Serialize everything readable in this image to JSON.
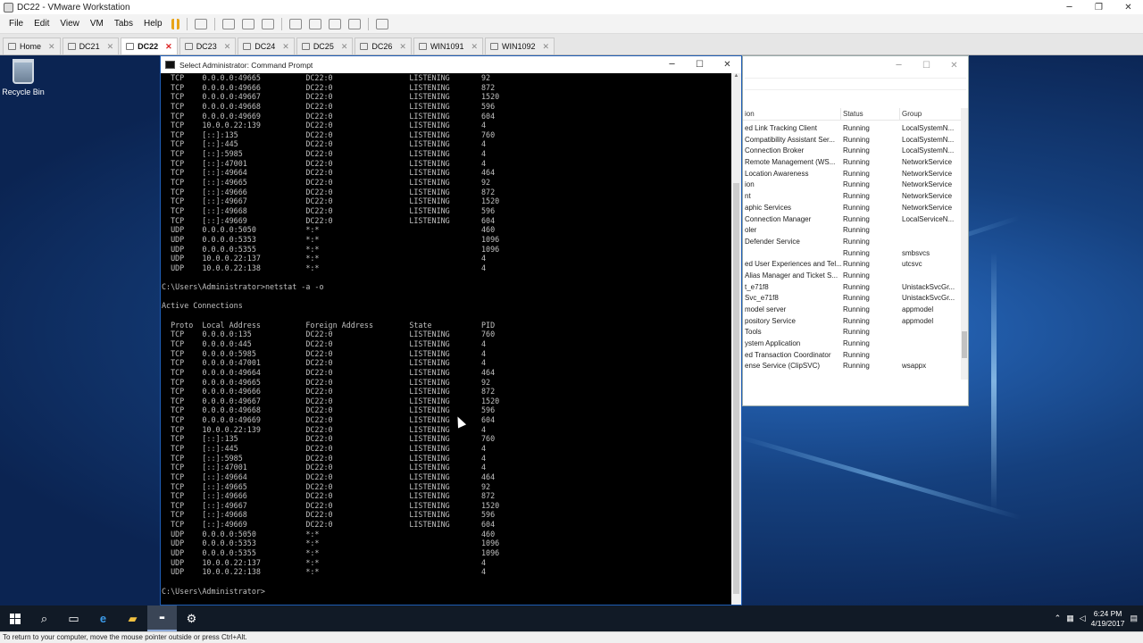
{
  "vmware": {
    "title": "DC22 - VMware Workstation",
    "controls": {
      "minimize": "─",
      "restore": "❐",
      "close": "✕"
    },
    "menus": [
      "File",
      "Edit",
      "View",
      "VM",
      "Tabs",
      "Help"
    ],
    "tabs": [
      {
        "label": "Home",
        "active": false
      },
      {
        "label": "DC21",
        "active": false
      },
      {
        "label": "DC22",
        "active": true
      },
      {
        "label": "DC23",
        "active": false
      },
      {
        "label": "DC24",
        "active": false
      },
      {
        "label": "DC25",
        "active": false
      },
      {
        "label": "DC26",
        "active": false
      },
      {
        "label": "WIN1091",
        "active": false
      },
      {
        "label": "WIN1092",
        "active": false
      }
    ],
    "tab_close": "✕",
    "status_bar": "To return to your computer, move the mouse pointer outside or press Ctrl+Alt."
  },
  "desktop": {
    "recycle_bin_label": "Recycle Bin"
  },
  "cmd": {
    "title": "Select Administrator: Command Prompt",
    "controls": {
      "minimize": "─",
      "maximize": "☐",
      "close": "✕"
    },
    "lines": [
      "  TCP    0.0.0.0:49665          DC22:0                 LISTENING       92",
      "  TCP    0.0.0.0:49666          DC22:0                 LISTENING       872",
      "  TCP    0.0.0.0:49667          DC22:0                 LISTENING       1520",
      "  TCP    0.0.0.0:49668          DC22:0                 LISTENING       596",
      "  TCP    0.0.0.0:49669          DC22:0                 LISTENING       604",
      "  TCP    10.0.0.22:139          DC22:0                 LISTENING       4",
      "  TCP    [::]:135               DC22:0                 LISTENING       760",
      "  TCP    [::]:445               DC22:0                 LISTENING       4",
      "  TCP    [::]:5985              DC22:0                 LISTENING       4",
      "  TCP    [::]:47001             DC22:0                 LISTENING       4",
      "  TCP    [::]:49664             DC22:0                 LISTENING       464",
      "  TCP    [::]:49665             DC22:0                 LISTENING       92",
      "  TCP    [::]:49666             DC22:0                 LISTENING       872",
      "  TCP    [::]:49667             DC22:0                 LISTENING       1520",
      "  TCP    [::]:49668             DC22:0                 LISTENING       596",
      "  TCP    [::]:49669             DC22:0                 LISTENING       604",
      "  UDP    0.0.0.0:5050           *:*                                    460",
      "  UDP    0.0.0.0:5353           *:*                                    1096",
      "  UDP    0.0.0.0:5355           *:*                                    1096",
      "  UDP    10.0.0.22:137          *:*                                    4",
      "  UDP    10.0.0.22:138          *:*                                    4",
      "",
      "C:\\Users\\Administrator>netstat -a -o",
      "",
      "Active Connections",
      "",
      "  Proto  Local Address          Foreign Address        State           PID",
      "  TCP    0.0.0.0:135            DC22:0                 LISTENING       760",
      "  TCP    0.0.0.0:445            DC22:0                 LISTENING       4",
      "  TCP    0.0.0.0:5985           DC22:0                 LISTENING       4",
      "  TCP    0.0.0.0:47001          DC22:0                 LISTENING       4",
      "  TCP    0.0.0.0:49664          DC22:0                 LISTENING       464",
      "  TCP    0.0.0.0:49665          DC22:0                 LISTENING       92",
      "  TCP    0.0.0.0:49666          DC22:0                 LISTENING       872",
      "  TCP    0.0.0.0:49667          DC22:0                 LISTENING       1520",
      "  TCP    0.0.0.0:49668          DC22:0                 LISTENING       596",
      "  TCP    0.0.0.0:49669          DC22:0                 LISTENING       604",
      "  TCP    10.0.0.22:139          DC22:0                 LISTENING       4",
      "  TCP    [::]:135               DC22:0                 LISTENING       760",
      "  TCP    [::]:445               DC22:0                 LISTENING       4",
      "  TCP    [::]:5985              DC22:0                 LISTENING       4",
      "  TCP    [::]:47001             DC22:0                 LISTENING       4",
      "  TCP    [::]:49664             DC22:0                 LISTENING       464",
      "  TCP    [::]:49665             DC22:0                 LISTENING       92",
      "  TCP    [::]:49666             DC22:0                 LISTENING       872",
      "  TCP    [::]:49667             DC22:0                 LISTENING       1520",
      "  TCP    [::]:49668             DC22:0                 LISTENING       596",
      "  TCP    [::]:49669             DC22:0                 LISTENING       604",
      "  UDP    0.0.0.0:5050           *:*                                    460",
      "  UDP    0.0.0.0:5353           *:*                                    1096",
      "  UDP    0.0.0.0:5355           *:*                                    1096",
      "  UDP    10.0.0.22:137          *:*                                    4",
      "  UDP    10.0.0.22:138          *:*                                    4",
      "",
      "C:\\Users\\Administrator>"
    ]
  },
  "services": {
    "controls": {
      "minimize": "─",
      "maximize": "☐",
      "close": "✕"
    },
    "columns": [
      "ion",
      "Status",
      "Group"
    ],
    "rows": [
      {
        "name": "ed Link Tracking Client",
        "status": "Running",
        "group": "LocalSystemN..."
      },
      {
        "name": "Compatibility Assistant Ser...",
        "status": "Running",
        "group": "LocalSystemN..."
      },
      {
        "name": "Connection Broker",
        "status": "Running",
        "group": "LocalSystemN..."
      },
      {
        "name": "Remote Management (WS...",
        "status": "Running",
        "group": "NetworkService"
      },
      {
        "name": "Location Awareness",
        "status": "Running",
        "group": "NetworkService"
      },
      {
        "name": "ion",
        "status": "Running",
        "group": "NetworkService"
      },
      {
        "name": "nt",
        "status": "Running",
        "group": "NetworkService"
      },
      {
        "name": "aphic Services",
        "status": "Running",
        "group": "NetworkService"
      },
      {
        "name": "Connection Manager",
        "status": "Running",
        "group": "LocalServiceN..."
      },
      {
        "name": "oler",
        "status": "Running",
        "group": ""
      },
      {
        "name": "Defender Service",
        "status": "Running",
        "group": ""
      },
      {
        "name": "",
        "status": "Running",
        "group": "smbsvcs"
      },
      {
        "name": "ed User Experiences and Tel...",
        "status": "Running",
        "group": "utcsvc"
      },
      {
        "name": "Alias Manager and Ticket S...",
        "status": "Running",
        "group": ""
      },
      {
        "name": "t_e71f8",
        "status": "Running",
        "group": "UnistackSvcGr..."
      },
      {
        "name": "Svc_e71f8",
        "status": "Running",
        "group": "UnistackSvcGr..."
      },
      {
        "name": "model server",
        "status": "Running",
        "group": "appmodel"
      },
      {
        "name": "pository Service",
        "status": "Running",
        "group": "appmodel"
      },
      {
        "name": "Tools",
        "status": "Running",
        "group": ""
      },
      {
        "name": "ystem Application",
        "status": "Running",
        "group": ""
      },
      {
        "name": "ed Transaction Coordinator",
        "status": "Running",
        "group": ""
      },
      {
        "name": "ense Service (ClipSVC)",
        "status": "Running",
        "group": "wsappx"
      }
    ]
  },
  "taskbar": {
    "time": "6:24 PM",
    "date": "4/19/2017"
  },
  "colors": {
    "console_text": "#c0c0c0",
    "console_bg": "#000000",
    "active_tab_close": "#dd2222"
  }
}
